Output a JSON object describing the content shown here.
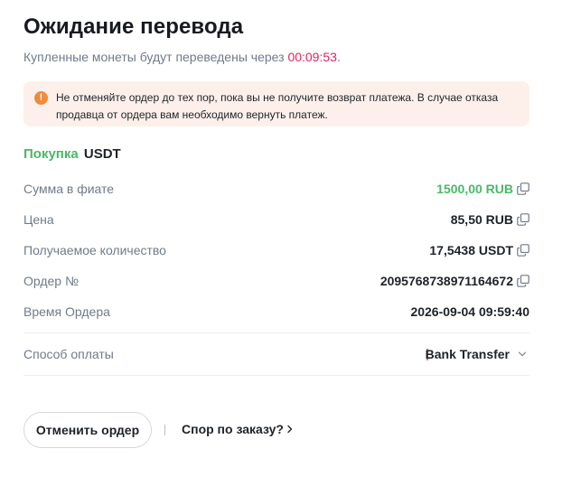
{
  "header": {
    "title": "Ожидание перевода",
    "subtitle_prefix": "Купленные монеты будут переведены через",
    "timer": "00:09:53",
    "subtitle_suffix": "."
  },
  "notice": {
    "icon": "warning-icon",
    "text": "Не отменяйте ордер до тех пор, пока вы не получите возврат платежа. В случае отказа продавца от ордера вам необходимо вернуть платеж."
  },
  "trade": {
    "side": "Покупка",
    "asset": "USDT"
  },
  "details": {
    "fiat_amount": {
      "label": "Сумма в фиате",
      "value": "1500,00 RUB"
    },
    "price": {
      "label": "Цена",
      "value": "85,50 RUB"
    },
    "quantity": {
      "label": "Получаемое количество",
      "value": "17,5438 USDT"
    },
    "order_no": {
      "label": "Ордер №",
      "value": "2095768738971164672"
    },
    "order_time": {
      "label": "Время Ордера",
      "value": "2026-09-04 09:59:40"
    }
  },
  "payment": {
    "label": "Способ оплаты",
    "method": "Bank Transfer"
  },
  "actions": {
    "cancel_label": "Отменить ордер",
    "dispute_label": "Спор по заказу?"
  },
  "colors": {
    "accent_green": "#4bb866",
    "timer_red": "#e0245e",
    "notice_bg": "#fdf0ea",
    "warning_orange": "#f08a3c"
  }
}
